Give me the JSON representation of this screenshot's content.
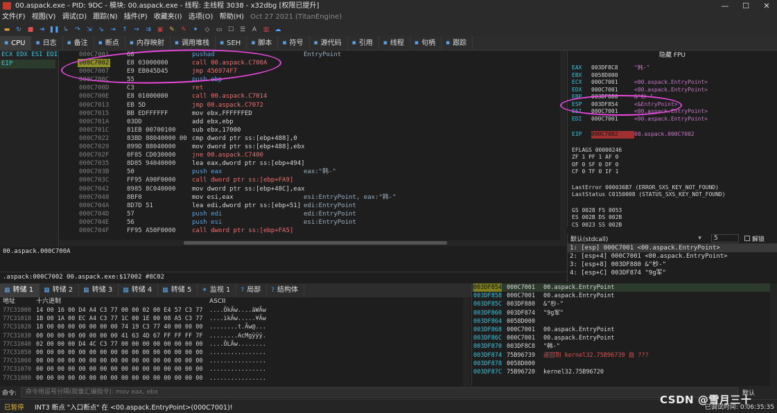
{
  "window": {
    "title": "00.aspack.exe - PID: 9DC - 模块: 00.aspack.exe - 线程: 主线程 3038 - x32dbg [权限已提升]",
    "controls": [
      "—",
      "☐",
      "✕"
    ]
  },
  "menu": {
    "items": [
      "文件(F)",
      "视图(V)",
      "调试(D)",
      "跟踪(N)",
      "插件(P)",
      "收藏夹(I)",
      "选项(O)",
      "帮助(H)"
    ],
    "date": "Oct 27 2021 (TitanEngine)"
  },
  "tabs": [
    {
      "label": "CPU",
      "icon": "cpu-icon"
    },
    {
      "label": "日志",
      "icon": "log-icon"
    },
    {
      "label": "备注",
      "icon": "notes-icon"
    },
    {
      "label": "断点",
      "icon": "breakpoint-icon"
    },
    {
      "label": "内存映射",
      "icon": "memory-icon"
    },
    {
      "label": "调用堆栈",
      "icon": "callstack-icon"
    },
    {
      "label": "SEH",
      "icon": "seh-icon"
    },
    {
      "label": "脚本",
      "icon": "script-icon"
    },
    {
      "label": "符号",
      "icon": "symbol-icon"
    },
    {
      "label": "源代码",
      "icon": "source-icon"
    },
    {
      "label": "引用",
      "icon": "reference-icon"
    },
    {
      "label": "线程",
      "icon": "thread-icon"
    },
    {
      "label": "句柄",
      "icon": "handle-icon"
    },
    {
      "label": "跟踪",
      "icon": "trace-icon"
    }
  ],
  "side_regs": {
    "line1": "ECX EDX ESI EDI",
    "line2": "EIP"
  },
  "disasm": [
    {
      "addr": "000C7001",
      "bytes": "60",
      "ins": "pushad",
      "cmt": "EntryPoint",
      "kind": "push"
    },
    {
      "addr": "000C7002",
      "bytes": "E8 03000000",
      "ins": "call 00.aspack.C700A",
      "cmt": "",
      "kind": "call",
      "sel": true
    },
    {
      "addr": "000C7007",
      "bytes": "E9 EB045D45",
      "ins": "jmp 456974F7",
      "cmt": "",
      "kind": "jmp"
    },
    {
      "addr": "000C700C",
      "bytes": "55",
      "ins": "push ebp",
      "cmt": "",
      "kind": "push"
    },
    {
      "addr": "000C700D",
      "bytes": "C3",
      "ins": "ret",
      "cmt": "",
      "kind": "jmp"
    },
    {
      "addr": "000C700E",
      "bytes": "E8 01000000",
      "ins": "call 00.aspack.C7014",
      "cmt": "",
      "kind": "call"
    },
    {
      "addr": "000C7013",
      "bytes": "EB 5D",
      "ins": "jmp 00.aspack.C7072",
      "cmt": "",
      "kind": "jmp"
    },
    {
      "addr": "000C7015",
      "bytes": "BB EDFFFFFF",
      "ins": "mov ebx,FFFFFFED",
      "cmt": "",
      "kind": "mov"
    },
    {
      "addr": "000C701A",
      "bytes": "03DD",
      "ins": "add ebx,ebp",
      "cmt": "",
      "kind": "mov"
    },
    {
      "addr": "000C701C",
      "bytes": "81EB 00700100",
      "ins": "sub ebx,17000",
      "cmt": "",
      "kind": "mov"
    },
    {
      "addr": "000C7022",
      "bytes": "83BD 88040000 00",
      "ins": "cmp dword ptr ss:[ebp+488],0",
      "cmt": "",
      "kind": "mov"
    },
    {
      "addr": "000C7029",
      "bytes": "899D 88040000",
      "ins": "mov dword ptr ss:[ebp+488],ebx",
      "cmt": "",
      "kind": "mov"
    },
    {
      "addr": "000C702F",
      "bytes": "0F85 CD030000",
      "ins": "jne 00.aspack.C7400",
      "cmt": "",
      "kind": "jmp"
    },
    {
      "addr": "000C7035",
      "bytes": "8D85 94040000",
      "ins": "lea eax,dword ptr ss:[ebp+494]",
      "cmt": "",
      "kind": "mov"
    },
    {
      "addr": "000C703B",
      "bytes": "50",
      "ins": "push eax",
      "cmt": "eax:\"韩-\"",
      "kind": "push"
    },
    {
      "addr": "000C703C",
      "bytes": "FF95 A90F0000",
      "ins": "call dword ptr ss:[ebp+FA9]",
      "cmt": "",
      "kind": "call"
    },
    {
      "addr": "000C7042",
      "bytes": "8985 8C040000",
      "ins": "mov dword ptr ss:[ebp+48C],eax",
      "cmt": "",
      "kind": "mov"
    },
    {
      "addr": "000C7048",
      "bytes": "8BF0",
      "ins": "mov esi,eax",
      "cmt": "esi:EntryPoint, eax:\"韩-\"",
      "kind": "mov"
    },
    {
      "addr": "000C704A",
      "bytes": "8D7D 51",
      "ins": "lea edi,dword ptr ss:[ebp+51]",
      "cmt": "edi:EntryPoint",
      "kind": "mov"
    },
    {
      "addr": "000C704D",
      "bytes": "57",
      "ins": "push edi",
      "cmt": "edi:EntryPoint",
      "kind": "push"
    },
    {
      "addr": "000C704E",
      "bytes": "56",
      "ins": "push esi",
      "cmt": "esi:EntryPoint",
      "kind": "push"
    },
    {
      "addr": "000C704F",
      "bytes": "FF95 A50F0000",
      "ins": "call dword ptr ss:[ebp+FA5]",
      "cmt": "",
      "kind": "call"
    }
  ],
  "infobar": {
    "line1": "00.aspack.000C700A",
    "line2": ".aspack:000C7002 00.aspack.exe:$17002 #8C02"
  },
  "regs": {
    "header": "隐藏 FPU",
    "rows": [
      {
        "n": "EAX",
        "v": "003DF8C8",
        "c": "\"韩-\""
      },
      {
        "n": "EBX",
        "v": "0058D000",
        "c": ""
      },
      {
        "n": "ECX",
        "v": "000C7001",
        "c": "<00.aspack.EntryPoint>"
      },
      {
        "n": "EDX",
        "v": "000C7001",
        "c": "<00.aspack.EntryPoint>"
      },
      {
        "n": "EBP",
        "v": "003DF880",
        "c": "&\"杪-\""
      },
      {
        "n": "ESP",
        "v": "003DF854",
        "c": "<&EntryPoint>"
      },
      {
        "n": "ESI",
        "v": "000C7001",
        "c": "<00.aspack.EntryPoint>"
      },
      {
        "n": "EDI",
        "v": "000C7001",
        "c": "<00.aspack.EntryPoint>"
      }
    ],
    "eip": {
      "n": "EIP",
      "v": "000C7002",
      "c": "00.aspack.000C7002"
    },
    "flags": [
      "EFLAGS   00000246",
      "ZF 1  PF 1  AF 0",
      "OF 0  SF 0  DF 0",
      "CF 0  TF 0  IF 1"
    ],
    "errors": [
      "LastError  000036B7 (ERROR_SXS_KEY_NOT_FOUND)",
      "LastStatus C0150008 (STATUS_SXS_KEY_NOT_FOUND)"
    ],
    "segs": [
      "GS 0028  FS 0053",
      "ES 002B  DS 002B",
      "CS 0023  SS 002B"
    ]
  },
  "callconv": {
    "label": "默认(stdcall)",
    "count": "5",
    "unlock": "解锁",
    "rows": [
      "1: [esp] 000C7001 <00.aspack.EntryPoint>",
      "2: [esp+4] 000C7001 <00.aspack.EntryPoint>",
      "3: [esp+8] 003DF880 &\"杪-\"",
      "4: [esp+C] 003DF874 \"9g军\""
    ]
  },
  "dumptabs": [
    "转储 1",
    "转储 2",
    "转储 3",
    "转储 4",
    "转储 5",
    "监视 1",
    "局部",
    "结构体"
  ],
  "dump": {
    "hdr_addr": "地址",
    "hdr_hex": "十六进制",
    "hdr_ascii": "ASCII",
    "rows": [
      {
        "a": "77C31000",
        "h": "14 00 16 00 D4 A4 C3 77 00 00 02 00 E4 57 C3 77",
        "s": "....ÔkÃw....äWÃw"
      },
      {
        "a": "77C31010",
        "h": "1B 00 1A 00 EC A4 C3 77 1C 00 1E 00 08 A5 C3 77",
        "s": "....ìkÃw.....¥Ãw"
      },
      {
        "a": "77C31020",
        "h": "18 00 00 00 00 00 00 00 74 19 C3 77 40 00 00 00",
        "s": "........t.Ãw@..."
      },
      {
        "a": "77C31030",
        "h": "00 00 00 00 00 00 00 00 41 63 4D 67 FF FF FF 7F",
        "s": "........AcMgÿÿÿ."
      },
      {
        "a": "77C31040",
        "h": "02 00 00 00 D4 4C C3 77 00 00 00 00 00 00 00 00",
        "s": "....ÔLÃw........"
      },
      {
        "a": "77C31050",
        "h": "00 00 00 00 00 00 00 00 00 00 00 00 00 00 00 00",
        "s": "................"
      },
      {
        "a": "77C31060",
        "h": "00 00 00 00 00 00 00 00 00 00 00 00 00 00 00 00",
        "s": "................"
      },
      {
        "a": "77C31070",
        "h": "00 00 00 00 00 00 00 00 00 00 00 00 00 00 00 00",
        "s": "................"
      },
      {
        "a": "77C31080",
        "h": "00 00 00 00 00 00 00 00 00 00 00 00 00 00 00 00",
        "s": "................"
      }
    ]
  },
  "stack": [
    {
      "a": "003DF854",
      "v": "000C7001",
      "c": "00.aspack.EntryPoint",
      "sel": true
    },
    {
      "a": "003DF858",
      "v": "000C7001",
      "c": "00.aspack.EntryPoint"
    },
    {
      "a": "003DF85C",
      "v": "003DF880",
      "c": "&\"杪-\""
    },
    {
      "a": "003DF860",
      "v": "003DF874",
      "c": "\"9g军\""
    },
    {
      "a": "003DF864",
      "v": "0058D000",
      "c": ""
    },
    {
      "a": "003DF868",
      "v": "000C7001",
      "c": "00.aspack.EntryPoint"
    },
    {
      "a": "003DF86C",
      "v": "000C7001",
      "c": "00.aspack.EntryPoint"
    },
    {
      "a": "003DF870",
      "v": "003DF8C8",
      "c": "\"韩-\""
    },
    {
      "a": "003DF874",
      "v": "75B96739",
      "c": "返回到 kernel32.75B96739 自 ???",
      "red": true
    },
    {
      "a": "003DF878",
      "v": "0058D000",
      "c": ""
    },
    {
      "a": "003DF87C",
      "v": "75B96720",
      "c": "kernel32.75B96720"
    }
  ],
  "cmd": {
    "label": "命令:",
    "placeholder": "命令用逗号分隔(就像汇编指令): mov eax, ebx",
    "default": "默认"
  },
  "status": {
    "state": "已暂停",
    "message": "INT3 断点 \"入口断点\" 在 <00.aspack.EntryPoint>(000C7001)!",
    "time": "已调试时间: 0:06:35:35"
  },
  "watermark": "CSDN @雪月三十"
}
